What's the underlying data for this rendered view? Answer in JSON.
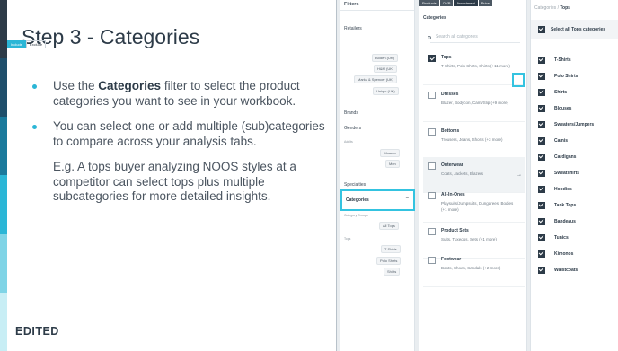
{
  "slide": {
    "title": "Step 3 - Categories",
    "bullet1_pre": "Use the ",
    "bullet1_bold": "Categories",
    "bullet1_post": " filter to select the product categories you want to see in your workbook.",
    "bullet2": "You can select one or add multiple (sub)categories to compare across your analysis tabs.",
    "bullet2_sub": "E.g. A tops buyer analyzing NOOS styles at a competitor can select tops plus multiple subcategories for more detailed insights.",
    "logo": "EDITED",
    "stripe_colors": [
      "#2d3b48",
      "#1f4f6b",
      "#1b7a9c",
      "#2bb6d6",
      "#7fd4e6",
      "#c8eef5"
    ]
  },
  "filters": {
    "header": "Filters",
    "retailers": "Retailers",
    "include": "Include",
    "exclude": "Exclude",
    "retailer_tags": [
      "Boden (UK)",
      "H&M (UK)",
      "Marks & Spencer (UK)",
      "Uniqlo (UK)"
    ],
    "brands": "Brands",
    "genders": "Genders",
    "adults": "Adults",
    "gender_tags": [
      "Women",
      "Men"
    ],
    "specialties": "Specialties",
    "categories": "Categories",
    "category_groups": "Category Groups",
    "group_tag": "All Tops",
    "tops_label": "Tops",
    "tops_tags": [
      "T-Shirts",
      "Polo Shirts",
      "Shirts"
    ]
  },
  "tabs": [
    "Products",
    "OVR",
    "Assortment",
    "Price"
  ],
  "categories": {
    "header": "Categories",
    "search_placeholder": "Search all categories",
    "items": [
      {
        "name": "Tops",
        "sub": "T-Shirts, Polo Shirts, Shirts (+11 more)",
        "checked": true
      },
      {
        "name": "Dresses",
        "sub": "Blazer, Bodycon, Cami/Slip (+9 more)",
        "checked": false
      },
      {
        "name": "Bottoms",
        "sub": "Trousers, Jeans, Shorts (+3 more)",
        "checked": false
      },
      {
        "name": "Outerwear",
        "sub": "Coats, Jackets, Blazers",
        "checked": false
      },
      {
        "name": "All-In-Ones",
        "sub": "Playsuits/Jumpsuits, Dungarees, Bodies (+1 more)",
        "checked": false
      },
      {
        "name": "Product Sets",
        "sub": "Suits, Tuxedos, Sets (+1 more)",
        "checked": false
      },
      {
        "name": "Footwear",
        "sub": "Boots, Shoes, Sandals (+2 more)",
        "checked": false
      }
    ]
  },
  "tops": {
    "breadcrumb_root": "Categories",
    "breadcrumb_current": "Tops",
    "select_all": "Select all Tops categories",
    "items": [
      "T-Shirts",
      "Polo Shirts",
      "Shirts",
      "Blouses",
      "Sweaters/Jumpers",
      "Camis",
      "Cardigans",
      "Sweatshirts",
      "Hoodies",
      "Tank Tops",
      "Bandeaus",
      "Tunics",
      "Kimonos",
      "Waistcoats"
    ]
  }
}
